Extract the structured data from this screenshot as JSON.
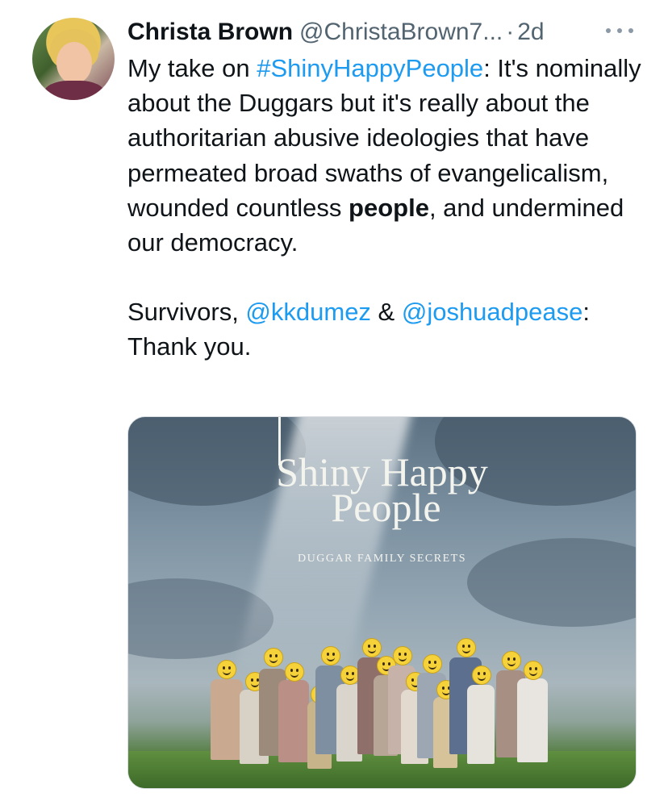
{
  "tweet": {
    "author_name": "Christa Brown",
    "handle": "@ChristaBrown7...",
    "separator": "·",
    "time": "2d",
    "more_label": "···",
    "text": {
      "p1_a": "My take on ",
      "p1_hashtag": "#ShinyHappyPeople",
      "p1_b": ": It's nominally about the Duggars but it's really about the authoritarian abusive ideologies that have permeated broad swaths of evangelicalism, wounded countless ",
      "p1_bold": "people",
      "p1_c": ", and undermined our democracy.",
      "p2_a": "Survivors, ",
      "p2_mention1": "@kkdumez",
      "p2_b": " & ",
      "p2_mention2": "@joshuadpease",
      "p2_c": ": Thank you."
    }
  },
  "media": {
    "title_line1": "Shiny Happy",
    "title_line2": "People",
    "subtitle": "DUGGAR FAMILY SECRETS"
  },
  "colors": {
    "text": "#0f1419",
    "secondary": "#536471",
    "link": "#1d9bf0"
  }
}
